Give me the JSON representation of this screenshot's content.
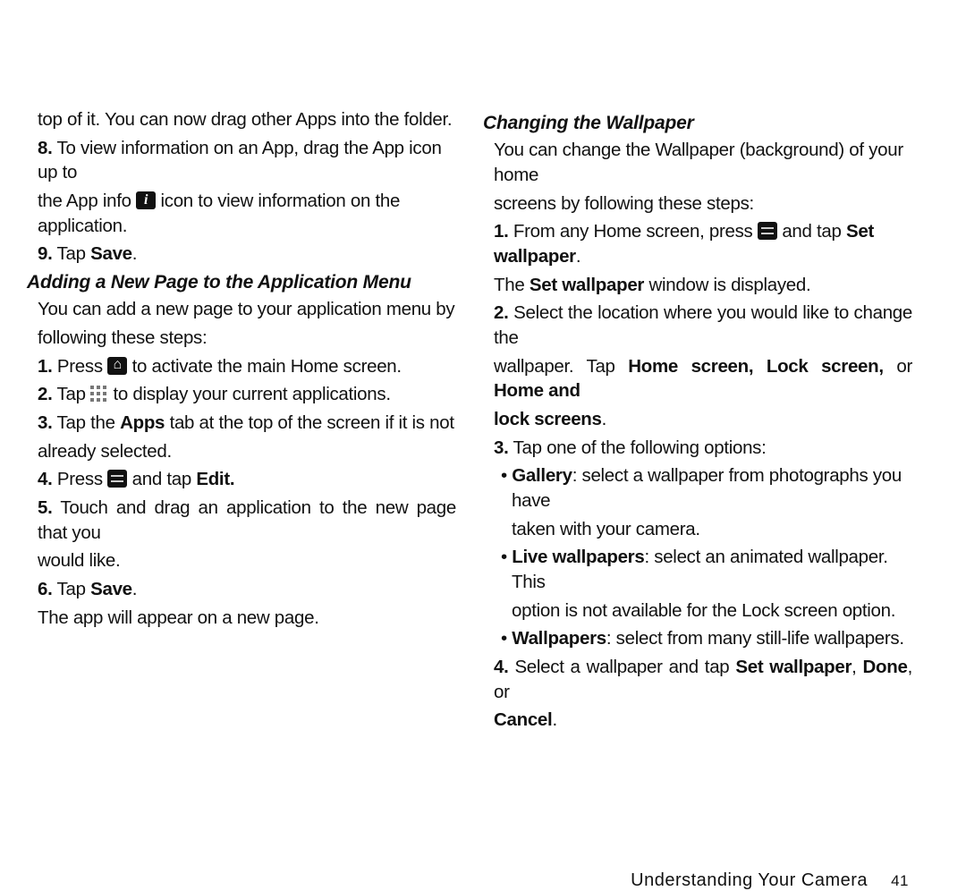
{
  "left": {
    "line_top": "top of it. You can now drag other Apps into the folder.",
    "step8_a": "To view information on an App, drag the App icon up to",
    "step8_b": "the App info",
    "step8_c": "icon to view information on the application.",
    "step9_prefix": "9.",
    "tap": "Tap",
    "save": "Save",
    "subhead": "Adding a New Page to the Application Menu",
    "intro_a": "You can add a new page to your application menu by",
    "intro_b": "following these steps:",
    "s1_a": "Press",
    "s1_b": "to activate the main Home screen.",
    "s2_a": "Tap",
    "s2_b": "to display your current applications.",
    "s3_a": "Tap the",
    "s3_apps": "Apps",
    "s3_b": "tab at the top of the screen if it is not",
    "s3_c": "already selected.",
    "s4_a": "Press",
    "s4_b": "and tap",
    "s4_edit": "Edit",
    "s5_a": "Touch and drag an application to the new page that you",
    "s5_b": "would like.",
    "s6_a": "Tap",
    "s6_save": "Save",
    "s6_b": "The app will appear on a new page."
  },
  "right": {
    "subhead": "Changing the Wallpaper",
    "intro_a": "You can change the Wallpaper (background) of your home",
    "intro_b": "screens by following these steps:",
    "s1_a": "From any Home screen, press",
    "s1_b": "and tap",
    "s1_setwp": "Set wallpaper",
    "s1_c": "The",
    "s1_setwp2": "Set wallpaper",
    "s1_d": "window is displayed.",
    "s2_a": "Select the location where you would like to change the",
    "s2_b": "wallpaper. Tap",
    "s2_opts": "Home screen, Lock screen,",
    "s2_or": "or",
    "s2_opts2": "Home and",
    "s2_opts3": "lock screens",
    "s3": "Tap one of the following options:",
    "b1_t": "Gallery",
    "b1_a": ": select a wallpaper from photographs you have",
    "b1_b": "taken with your camera.",
    "b2_t": "Live wallpapers",
    "b2_a": ": select an animated wallpaper. This",
    "b2_b": "option is not available for the Lock screen option.",
    "b3_t": "Wallpapers",
    "b3_a": ": select from many still-life wallpapers.",
    "s4_a": "Select a wallpaper and tap",
    "s4_b": "Set wallpaper",
    "s4_c": "Done",
    "s4_or": ", or",
    "s4_d": "Cancel"
  },
  "footer": {
    "title": "Understanding Your Camera",
    "page": "41"
  }
}
